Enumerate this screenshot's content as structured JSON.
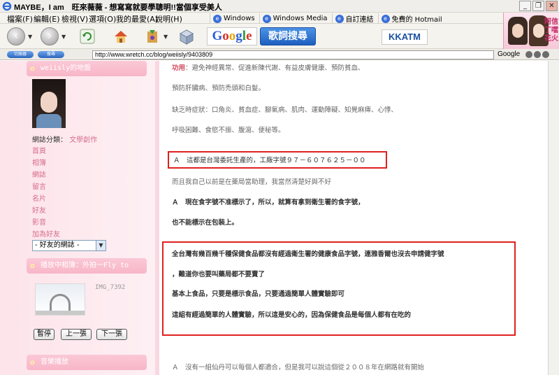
{
  "window": {
    "title": "MAYBE，I am　旺來薇薇 - 想寫寫就要學聰明!!當個享受美人",
    "minimize": "_",
    "restore": "❐",
    "close": "✕"
  },
  "menu": {
    "items": [
      "檔案(F)",
      "編輯(E)",
      "檢視(V)",
      "選項(O)",
      "我的最愛(A)",
      "說明(H)"
    ]
  },
  "links": [
    "Windows",
    "Windows Media",
    "自訂連結",
    "免費的 Hotmail"
  ],
  "toolbar": {
    "google_text": "Google",
    "lyric_search": "歌詞搜尋",
    "kkatm": "KKATM"
  },
  "ad": {
    "text": "阿信 丁噹 花火"
  },
  "address": {
    "url": "http://www.wretch.cc/blog/weiisly/9403809",
    "search_engine": "Google",
    "pill_left": "切換器",
    "pill_right": "搜尋"
  },
  "sidebar": {
    "header1": "weiisly的地盤",
    "category_label": "網誌分類：",
    "category_value": "文學創作",
    "nav": [
      "首頁",
      "相簿",
      "網誌",
      "留言",
      "名片",
      "好友",
      "影音",
      "加為好友"
    ],
    "friend_select": "- 好友的網誌 -",
    "header2": "播放中相簿：外拍一Fly to",
    "photo_caption": "IMG_7392",
    "buttons": [
      "暫停",
      "上一張",
      "下一張"
    ],
    "header3": "音樂播放"
  },
  "content": {
    "line1_lead": "功用",
    "line1_rest": "：避免神經異常、促進新陳代謝、有益皮膚健康、預防貧血、",
    "line2": "預防肝臟病、預防禿頭和白髮。",
    "line3": "缺乏時症狀：口角炎、貧血症、腳氣病、肌肉、運動障礙、知覺麻痺、心悸、",
    "line4": "呼吸困難、食慾不振、腹瀉、便秘等。",
    "line5": "Ａ　這都是台灣委託生產的，工廠字號９７－６０７６２５－００",
    "line6": "而且我自己以前是在藥局當助理，我當然清楚好與不好",
    "line7": "Ａ　現在食字號不准標示了，所以，就算有拿到衛生署的食字號，",
    "line8": "也不能標示在包裝上。",
    "line9": "全台灣有幾百幾千種保健食品都沒有經過衛生署的健康食品字號，連雅香爾也沒去申請健字號",
    "line10": "，難道你也要叫藥局都不要賣了",
    "line11": "基本上食品，只要是標示食品，只要通過簡單人體實驗即可",
    "line12": "這組有經過簡單的人體實驗，所以這是安心的，因為保健食品是每個人都有在吃的",
    "line13": "Ａ　沒有一組仙丹可以每個人都適合，但是我可以說這個從２００８年在網路就有開始"
  }
}
